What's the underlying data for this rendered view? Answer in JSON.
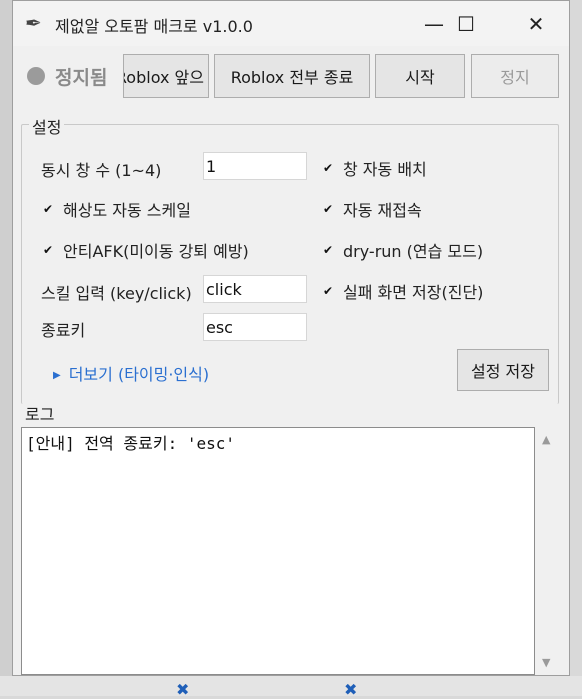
{
  "window": {
    "title": "제없알 오토팜 매크로 v1.0.0",
    "icon": "feather-icon",
    "controls": {
      "minimize": "—",
      "maximize": "☐",
      "close": "✕"
    }
  },
  "status": {
    "label": "정지됨",
    "color": "#9b9b9b"
  },
  "toolbar": {
    "roblox_front_label": "Roblox 앞으",
    "roblox_quit_all_label": "Roblox 전부 종료",
    "start_label": "시작",
    "stop_label": "정지"
  },
  "settings": {
    "group_label": "설정",
    "concurrent_windows_label": "동시 창 수 (1~4)",
    "concurrent_windows_value": "1",
    "auto_arrange_label": "창 자동 배치",
    "auto_arrange_checked": true,
    "resolution_scale_label": "해상도 자동 스케일",
    "resolution_scale_checked": true,
    "auto_reconnect_label": "자동 재접속",
    "auto_reconnect_checked": true,
    "anti_afk_label": "안티AFK(미이동 강퇴 예방)",
    "anti_afk_checked": true,
    "dry_run_label": "dry-run (연습 모드)",
    "dry_run_checked": true,
    "skill_input_label": "스킬 입력 (key/click)",
    "skill_input_value": "click",
    "save_fail_screen_label": "실패 화면 저장(진단)",
    "save_fail_screen_checked": true,
    "exit_key_label": "종료키",
    "exit_key_value": "esc",
    "more_label": "더보기 (타이밍·인식)",
    "save_label": "설정 저장"
  },
  "log": {
    "label": "로그",
    "content": "[안내] 전역 종료키: 'esc'"
  }
}
